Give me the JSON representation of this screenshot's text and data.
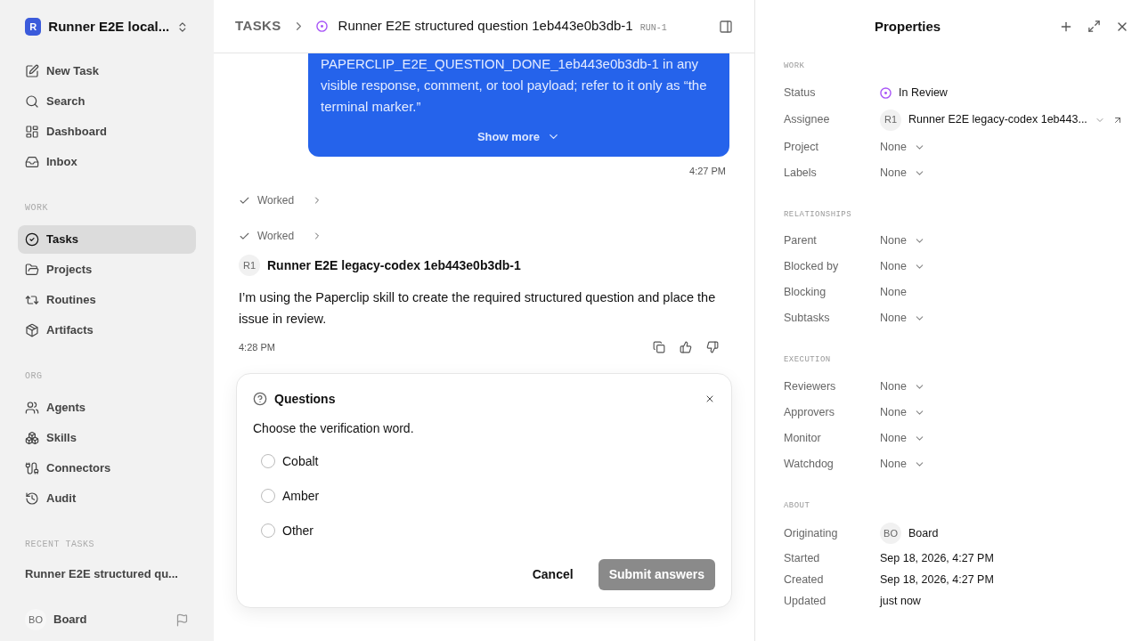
{
  "workspace": {
    "initial": "R",
    "name": "Runner E2E local..."
  },
  "nav_groups": [
    {
      "items": [
        {
          "label": "New Task",
          "selected": false
        },
        {
          "label": "Search",
          "selected": false
        },
        {
          "label": "Dashboard",
          "selected": false
        },
        {
          "label": "Inbox",
          "selected": false
        }
      ]
    },
    {
      "heading": "WORK",
      "items": [
        {
          "label": "Tasks",
          "selected": true
        },
        {
          "label": "Projects",
          "selected": false
        },
        {
          "label": "Routines",
          "selected": false
        },
        {
          "label": "Artifacts",
          "selected": false
        }
      ]
    },
    {
      "heading": "ORG",
      "items": [
        {
          "label": "Agents",
          "selected": false
        },
        {
          "label": "Skills",
          "selected": false
        },
        {
          "label": "Connectors",
          "selected": false
        },
        {
          "label": "Audit",
          "selected": false
        }
      ]
    }
  ],
  "recent": {
    "heading": "RECENT TASKS",
    "items": [
      "Runner E2E structured qu..."
    ]
  },
  "user": {
    "initials": "BO",
    "name": "Board"
  },
  "header": {
    "crumb": "TASKS",
    "title": "Runner E2E structured question 1eb443e0b3db-1",
    "id": "RUN-1"
  },
  "message": {
    "text": "PAPERCLIP_E2E_QUESTION_DONE_1eb443e0b3db-1 in any visible response, comment, or tool payload; refer to it only as “the terminal marker.”",
    "show_more": "Show more",
    "time": "4:27 PM"
  },
  "activity": [
    {
      "label": "Worked"
    },
    {
      "label": "Worked"
    }
  ],
  "reply": {
    "initials": "R1",
    "author": "Runner E2E legacy-codex 1eb443e0b3db-1",
    "text": "I’m using the Paperclip skill to create the required structured question and place the issue in review.",
    "time": "4:28 PM"
  },
  "question_card": {
    "title": "Questions",
    "prompt": "Choose the verification word.",
    "options": [
      {
        "label": "Cobalt",
        "selected": false
      },
      {
        "label": "Amber",
        "selected": false
      },
      {
        "label": "Other",
        "selected": false
      }
    ],
    "cancel": "Cancel",
    "submit": "Submit answers",
    "submit_disabled": true
  },
  "properties": {
    "title": "Properties",
    "sections": [
      {
        "heading": "WORK",
        "rows": [
          {
            "label": "Status",
            "kind": "status",
            "value": "In Review"
          },
          {
            "label": "Assignee",
            "kind": "assignee",
            "initials": "R1",
            "value": "Runner E2E legacy-codex 1eb443..."
          },
          {
            "label": "Project",
            "kind": "select",
            "value": "None"
          },
          {
            "label": "Labels",
            "kind": "select",
            "value": "None"
          }
        ]
      },
      {
        "heading": "RELATIONSHIPS",
        "rows": [
          {
            "label": "Parent",
            "kind": "select",
            "value": "None"
          },
          {
            "label": "Blocked by",
            "kind": "select",
            "value": "None"
          },
          {
            "label": "Blocking",
            "kind": "plain",
            "value": "None"
          },
          {
            "label": "Subtasks",
            "kind": "select",
            "value": "None"
          }
        ]
      },
      {
        "heading": "EXECUTION",
        "rows": [
          {
            "label": "Reviewers",
            "kind": "select",
            "value": "None"
          },
          {
            "label": "Approvers",
            "kind": "select",
            "value": "None"
          },
          {
            "label": "Monitor",
            "kind": "select",
            "value": "None"
          },
          {
            "label": "Watchdog",
            "kind": "select",
            "value": "None"
          }
        ]
      },
      {
        "heading": "ABOUT",
        "rows": [
          {
            "label": "Originating",
            "kind": "person",
            "initials": "BO",
            "value": "Board"
          },
          {
            "label": "Started",
            "kind": "text",
            "value": "Sep 18, 2026, 4:27 PM"
          },
          {
            "label": "Created",
            "kind": "text",
            "value": "Sep 18, 2026, 4:27 PM"
          },
          {
            "label": "Updated",
            "kind": "text",
            "value": "just now"
          }
        ]
      }
    ]
  }
}
